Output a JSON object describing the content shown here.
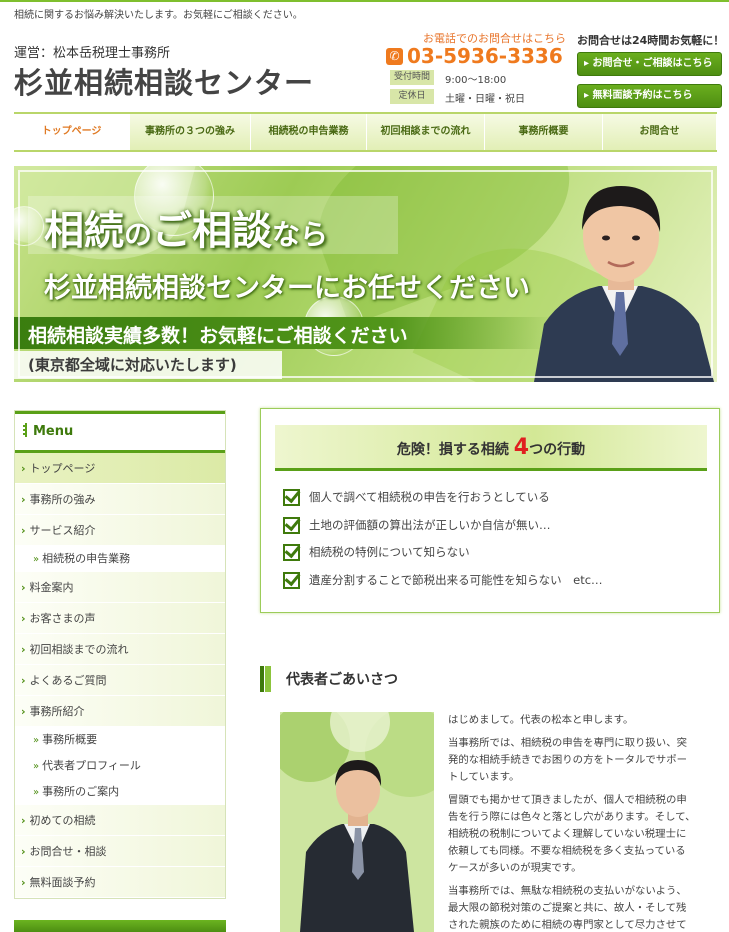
{
  "header": {
    "tagline": "相続に関するお悩み解決いたします。お気軽にご相談ください。",
    "operator": "運営：松本岳税理士事務所",
    "site_title": "杉並相続相談センター",
    "tel_note": "お電話でのお問合せはこちら",
    "tel_number": "03-5936-3336",
    "hours_label": "受付時間",
    "hours_value": "9:00〜18:00",
    "closed_label": "定休日",
    "closed_value": "土曜・日曜・祝日",
    "support_title": "お問合せは24時間お気軽に！",
    "cta_contact": "お問合せ・ご相談はこちら",
    "cta_booking": "無料面談予約はこちら"
  },
  "gnav": [
    {
      "label": "トップページ",
      "width": 116,
      "active": true
    },
    {
      "label": "事務所の３つの強み",
      "width": 121,
      "active": false
    },
    {
      "label": "相続税の申告業務",
      "width": 116,
      "active": false
    },
    {
      "label": "初回相談までの流れ",
      "width": 118,
      "active": false
    },
    {
      "label": "事務所概要",
      "width": 118,
      "active": false
    },
    {
      "label": "お問合せ",
      "width": 114,
      "active": false
    }
  ],
  "hero": {
    "line1_a": "相続",
    "line1_b": "の",
    "line1_c": "ご相談",
    "line1_d": "なら",
    "line2": "杉並相続相談センターにお任せください",
    "line3": "相続相談実績多数！お気軽にご相談ください",
    "line4": "(東京都全域に対応いたします)"
  },
  "sidebar": {
    "title": "Menu",
    "items": [
      {
        "type": "item",
        "label": "トップページ",
        "active": true
      },
      {
        "type": "item",
        "label": "事務所の強み"
      },
      {
        "type": "item",
        "label": "サービス紹介"
      },
      {
        "type": "sub",
        "label": "相続税の申告業務"
      },
      {
        "type": "item",
        "label": "料金案内"
      },
      {
        "type": "item",
        "label": "お客さまの声"
      },
      {
        "type": "item",
        "label": "初回相談までの流れ"
      },
      {
        "type": "item",
        "label": "よくあるご質問"
      },
      {
        "type": "item",
        "label": "事務所紹介"
      },
      {
        "type": "sub",
        "label": "事務所概要"
      },
      {
        "type": "sub",
        "label": "代表者プロフィール"
      },
      {
        "type": "sub",
        "label": "事務所のご案内"
      },
      {
        "type": "item",
        "label": "初めての相続"
      },
      {
        "type": "item",
        "label": "お問合せ・相談"
      },
      {
        "type": "item",
        "label": "無料面談予約"
      }
    ]
  },
  "danger": {
    "title_a": "危険！損する相続 ",
    "title_num": "4",
    "title_b": "つの行動",
    "items": [
      "個人で調べて相続税の申告を行おうとしている",
      "土地の評価額の算出法が正しいか自信が無い…",
      "相続税の特例について知らない",
      "遺産分割することで節税出来る可能性を知らない　etc…"
    ]
  },
  "greeting": {
    "title": "代表者ごあいさつ",
    "paragraphs": [
      "はじめまして。代表の松本と申します。",
      "当事務所では、相続税の申告を専門に取り扱い、突発的な相続手続きでお困りの方をトータルでサポートしています。",
      "冒頭でも掲かせて頂きましたが、個人で相続税の申告を行う際には色々と落とし穴があります。そして、相続税の税制についてよく理解していない税理士に依頼しても同様。不要な相続税を多く支払っているケースが多いのが現実です。",
      "当事務所では、無駄な相続税の支払いがないよう、最大限の節税対策のご提案と共に、故人・そして残された親族のために相続の専門家として尽力させて"
    ]
  },
  "colors": {
    "brand_green": "#5aa018",
    "accent_orange": "#ef7a1e",
    "alert_red": "#e01f1f"
  }
}
